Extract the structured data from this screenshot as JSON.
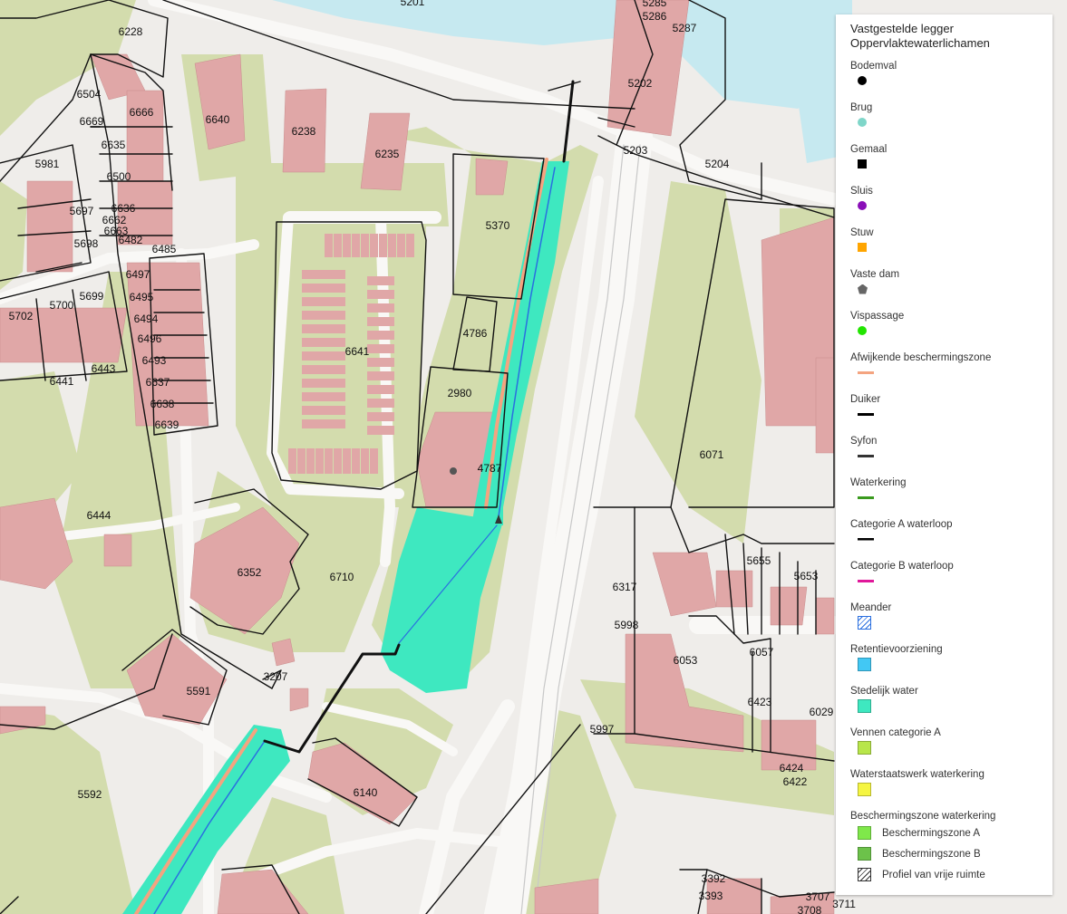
{
  "colors": {
    "background": "#efedea",
    "greenspace": "#d3dcad",
    "road": "#f9f8f6",
    "building": "#e0a7a7",
    "bldg_edge": "#c98d8d",
    "water": "#c6e9f0",
    "stedelijk_water": "#3ee8c0",
    "profile_strip": "#36d2c8",
    "parcel_line": "#111111",
    "orange_zone": "#f4a480",
    "blue_line": "#2a6fe0"
  },
  "parcel_labels": [
    "5201",
    "5285",
    "5286",
    "5287",
    "6228",
    "6504",
    "6669",
    "6666",
    "6635",
    "6500",
    "6640",
    "6238",
    "6235",
    "5981",
    "5697",
    "5698",
    "6636",
    "6662",
    "6663",
    "6482",
    "6485",
    "6497",
    "6495",
    "6494",
    "6496",
    "6493",
    "6637",
    "6638",
    "6639",
    "5699",
    "5700",
    "5702",
    "6441",
    "6443",
    "5202",
    "5203",
    "5204",
    "5370",
    "4786",
    "6641",
    "2980",
    "4787",
    "6071",
    "6444",
    "6352",
    "6710",
    "5591",
    "3207",
    "5592",
    "6140",
    "6317",
    "5998",
    "5655",
    "5653",
    "6053",
    "6057",
    "6423",
    "6029",
    "5997",
    "6424",
    "6422",
    "3392",
    "3393",
    "3707",
    "3711",
    "3708"
  ],
  "legend": {
    "title": "Vastgestelde legger\nOppervlaktewaterlichamen",
    "items": [
      {
        "label": "Bodemval",
        "symbol": "dot-icon",
        "color": "#000000"
      },
      {
        "label": "Brug",
        "symbol": "dot-icon",
        "color": "#7fd6c9"
      },
      {
        "label": "Gemaal",
        "symbol": "square-icon",
        "color": "#000000"
      },
      {
        "label": "Sluis",
        "symbol": "dot-icon",
        "color": "#8a0fb8"
      },
      {
        "label": "Stuw",
        "symbol": "square-icon",
        "color": "#ffa500"
      },
      {
        "label": "Vaste dam",
        "symbol": "pentagon-icon",
        "color": "#666666"
      },
      {
        "label": "Vispassage",
        "symbol": "dot-icon",
        "color": "#22e500"
      },
      {
        "label": "Afwijkende beschermingszone",
        "symbol": "line-icon",
        "color": "#f4a480"
      },
      {
        "label": "Duiker",
        "symbol": "line-icon",
        "color": "#000000"
      },
      {
        "label": "Syfon",
        "symbol": "line-icon",
        "color": "#333333"
      },
      {
        "label": "Waterkering",
        "symbol": "line-icon",
        "color": "#3a9a1e"
      },
      {
        "label": "Categorie A waterloop",
        "symbol": "arrow-line-icon",
        "color": "#000000"
      },
      {
        "label": "Categorie B waterloop",
        "symbol": "line-icon",
        "color": "#e0189a"
      },
      {
        "label": "Meander",
        "symbol": "hatch-icon",
        "color": "#2a6fe0"
      },
      {
        "label": "Retentievoorziening",
        "symbol": "fill-icon",
        "color": "#42c8f4"
      },
      {
        "label": "Stedelijk water",
        "symbol": "fill-icon",
        "color": "#3ee8c0"
      },
      {
        "label": "Vennen categorie A",
        "symbol": "fill-icon",
        "color": "#b8e64a"
      },
      {
        "label": "Waterstaatswerk waterkering",
        "symbol": "fill-icon",
        "color": "#f5f542"
      }
    ],
    "group": {
      "label": "Beschermingszone waterkering",
      "items": [
        {
          "label": "Beschermingszone A",
          "symbol": "fill-icon",
          "color": "#7fe84a"
        },
        {
          "label": "Beschermingszone B",
          "symbol": "fill-icon",
          "color": "#6cc24a"
        },
        {
          "label": "Profiel van vrije ruimte",
          "symbol": "hatch-icon",
          "color": "#333333"
        }
      ]
    }
  }
}
